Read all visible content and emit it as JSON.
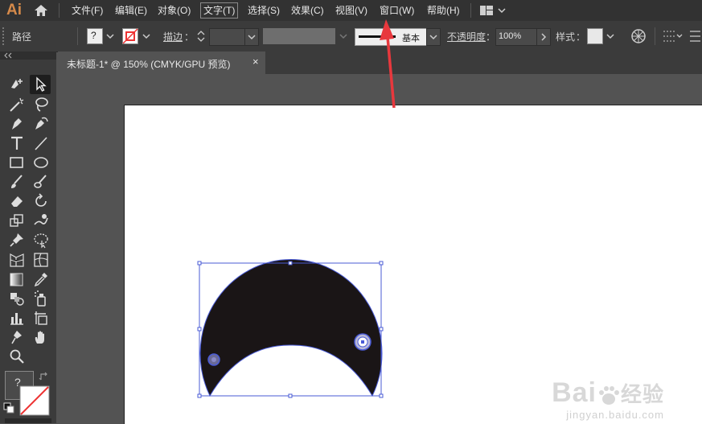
{
  "app": {
    "logo": "Ai"
  },
  "menu": {
    "items": [
      {
        "label": "文件(F)"
      },
      {
        "label": "编辑(E)"
      },
      {
        "label": "对象(O)"
      },
      {
        "label": "文字(T)"
      },
      {
        "label": "选择(S)"
      },
      {
        "label": "效果(C)"
      },
      {
        "label": "视图(V)"
      },
      {
        "label": "窗口(W)"
      },
      {
        "label": "帮助(H)"
      }
    ],
    "active_index": 3
  },
  "control_bar": {
    "selection_label": "路径",
    "fill_value": "?",
    "stroke_label": "描边",
    "stroke_colon": "：",
    "brush_label": "基本",
    "opacity_label": "不透明度",
    "opacity_colon": "：",
    "opacity_value": "100%",
    "style_label": "样式",
    "style_colon": "："
  },
  "document": {
    "tab_title": "未标题-1* @ 150% (CMYK/GPU 预览)",
    "close_glyph": "×"
  },
  "icons": [
    "home-icon",
    "workspace-layout-icon",
    "selection-tool-icon",
    "direct-selection-tool-icon",
    "magic-wand-icon",
    "lasso-icon",
    "pen-tool-icon",
    "curvature-tool-icon",
    "type-tool-icon",
    "line-tool-icon",
    "rectangle-tool-icon",
    "ellipse-tool-icon",
    "paintbrush-icon",
    "blob-brush-icon",
    "eraser-icon",
    "rotate-icon",
    "scale-icon",
    "warp-icon",
    "pin-icon",
    "shape-builder-icon",
    "perspective-grid-icon",
    "mesh-icon",
    "gradient-icon",
    "eyedropper-icon",
    "blend-icon",
    "symbol-sprayer-icon",
    "column-graph-icon",
    "artboard-tool-icon",
    "slice-icon",
    "hand-icon",
    "zoom-icon"
  ],
  "colors": {
    "accent_arrow": "#e8383d",
    "shape_fill": "#1a1516",
    "selection": "#4a5bd6",
    "logo": "#d68a4a"
  },
  "watermark": {
    "brand": "Bai",
    "brand_suffix": "经验",
    "url": "jingyan.baidu.com"
  }
}
